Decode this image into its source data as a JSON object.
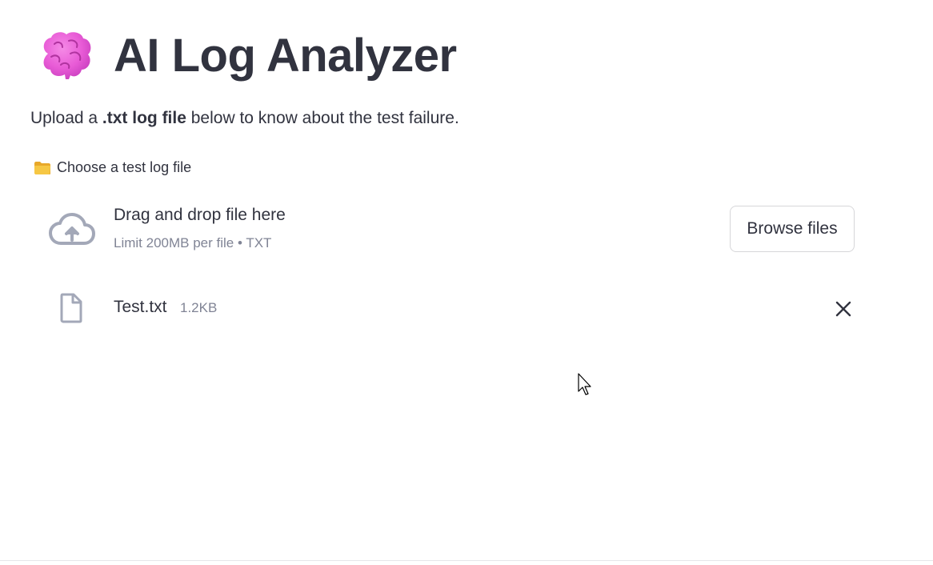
{
  "header": {
    "brain_icon": "brain-emoji-icon",
    "title": "AI Log Analyzer"
  },
  "description": {
    "prefix": "Upload a ",
    "bold": ".txt log file",
    "suffix": " below to know about the test failure."
  },
  "uploader": {
    "label_icon": "folder-emoji-icon",
    "label": "Choose a test log file",
    "dropzone_icon": "cloud-upload-icon",
    "dropzone_title": "Drag and drop file here",
    "dropzone_subtitle": "Limit 200MB per file • TXT",
    "browse_label": "Browse files"
  },
  "uploaded_file": {
    "icon": "file-icon",
    "name": "Test.txt",
    "size": "1.2KB",
    "remove_icon": "close-icon"
  },
  "colors": {
    "text": "#31333f",
    "muted": "#808495",
    "icon_gray": "#a3a8b8",
    "brain_pink": "#e85bd6",
    "folder_yellow": "#f6c744"
  }
}
